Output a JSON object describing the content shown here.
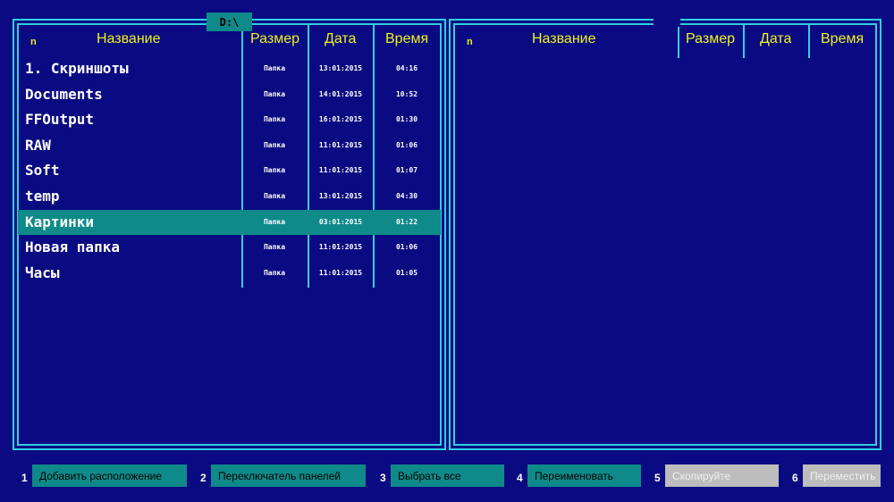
{
  "path_label": "D:\\",
  "columns": {
    "n": "n",
    "name": "Название",
    "size": "Размер",
    "date": "Дата",
    "time": "Время"
  },
  "left_panel": {
    "rows": [
      {
        "name": "1. Скриншоты",
        "size": "Папка",
        "date": "13:01:2015",
        "time": "04:16",
        "selected": false
      },
      {
        "name": "Documents",
        "size": "Папка",
        "date": "14:01:2015",
        "time": "10:52",
        "selected": false
      },
      {
        "name": "FFOutput",
        "size": "Папка",
        "date": "16:01:2015",
        "time": "01:30",
        "selected": false
      },
      {
        "name": "RAW",
        "size": "Папка",
        "date": "11:01:2015",
        "time": "01:06",
        "selected": false
      },
      {
        "name": "Soft",
        "size": "Папка",
        "date": "11:01:2015",
        "time": "01:07",
        "selected": false
      },
      {
        "name": "temp",
        "size": "Папка",
        "date": "13:01:2015",
        "time": "04:30",
        "selected": false
      },
      {
        "name": "Картинки",
        "size": "Папка",
        "date": "03:01:2015",
        "time": "01:22",
        "selected": true
      },
      {
        "name": "Новая папка",
        "size": "Папка",
        "date": "11:01:2015",
        "time": "01:06",
        "selected": false
      },
      {
        "name": "Часы",
        "size": "Папка",
        "date": "11:01:2015",
        "time": "01:05",
        "selected": false
      }
    ]
  },
  "function_keys": [
    {
      "num": "1",
      "label": "Добавить расположение",
      "enabled": true
    },
    {
      "num": "2",
      "label": "Переключатель панелей",
      "enabled": true
    },
    {
      "num": "3",
      "label": "Выбрать все",
      "enabled": true
    },
    {
      "num": "4",
      "label": "Переименовать",
      "enabled": true
    },
    {
      "num": "5",
      "label": "Скопируйте",
      "enabled": false
    },
    {
      "num": "6",
      "label": "Переместить",
      "enabled": false
    }
  ],
  "colors": {
    "background": "#0a0a82",
    "border": "#2fd0e0",
    "header_text": "#f0f020",
    "selection": "#0f8a8a",
    "disabled": "#bdbdbd"
  }
}
